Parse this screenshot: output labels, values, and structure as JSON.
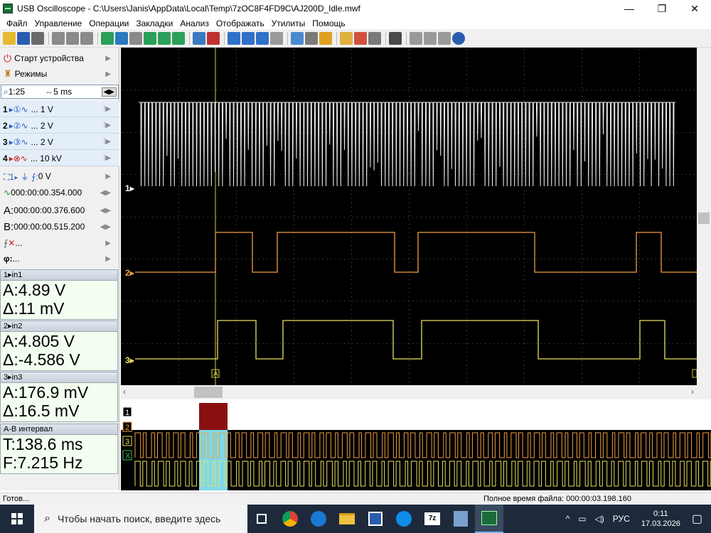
{
  "window": {
    "title": "USB Oscilloscope - C:\\Users\\Janis\\AppData\\Local\\Temp\\7zOC8F4FD9C\\AJ200D_Idle.mwf",
    "min": "—",
    "max": "❐",
    "close": "✕"
  },
  "menu": [
    "Файл",
    "Управление",
    "Операции",
    "Закладки",
    "Анализ",
    "Отображать",
    "Утилиты",
    "Помощь"
  ],
  "panel": {
    "start": "Старт устройства",
    "modes": "Режимы",
    "zoom": "1:25",
    "timebase": "5 ms",
    "channels": [
      {
        "num": "1",
        "scale": "... 1 V"
      },
      {
        "num": "2",
        "scale": "... 2 V"
      },
      {
        "num": "3",
        "scale": "... 2 V"
      },
      {
        "num": "4",
        "scale": "... 10 kV"
      }
    ],
    "trigger": "0 V",
    "trigger_time": "000:00:00.354.000",
    "cursor_a": "000:00:00.376.600",
    "cursor_b": "000:00:00.515.200",
    "cursor_a_label": "A:",
    "cursor_b_label": "B:",
    "fx": "...",
    "phi": "...",
    "meas": [
      {
        "head": "in1",
        "a": "A:4.89 V",
        "d": "Δ:11 mV"
      },
      {
        "head": "in2",
        "a": "A:4.805 V",
        "d": "Δ:-4.586 V"
      },
      {
        "head": "in3",
        "a": "A:176.9 mV",
        "d": "Δ:16.5 mV"
      }
    ],
    "interval_head": "A-B интервал",
    "interval_t": "T:138.6 ms",
    "interval_f": "F:7.215 Hz"
  },
  "scope": {
    "ch_labels": [
      "1",
      "2",
      "3"
    ],
    "cursor_a": "A",
    "cursor_b": "B",
    "colors": {
      "ch1": "#f0f0f0",
      "ch2": "#f0a040",
      "ch3": "#e8e060",
      "cursor": "#d8d040",
      "grid": "#505050"
    }
  },
  "overview": {
    "labels": [
      "1",
      "2",
      "3",
      "X"
    ]
  },
  "status": {
    "left": "Готов...",
    "right": "Полное время файла: 000:00:03.198.160"
  },
  "taskbar": {
    "search": "Чтобы начать поиск, введите здесь",
    "lang": "РУС",
    "time": "0:11",
    "date": "17.03.2026"
  }
}
